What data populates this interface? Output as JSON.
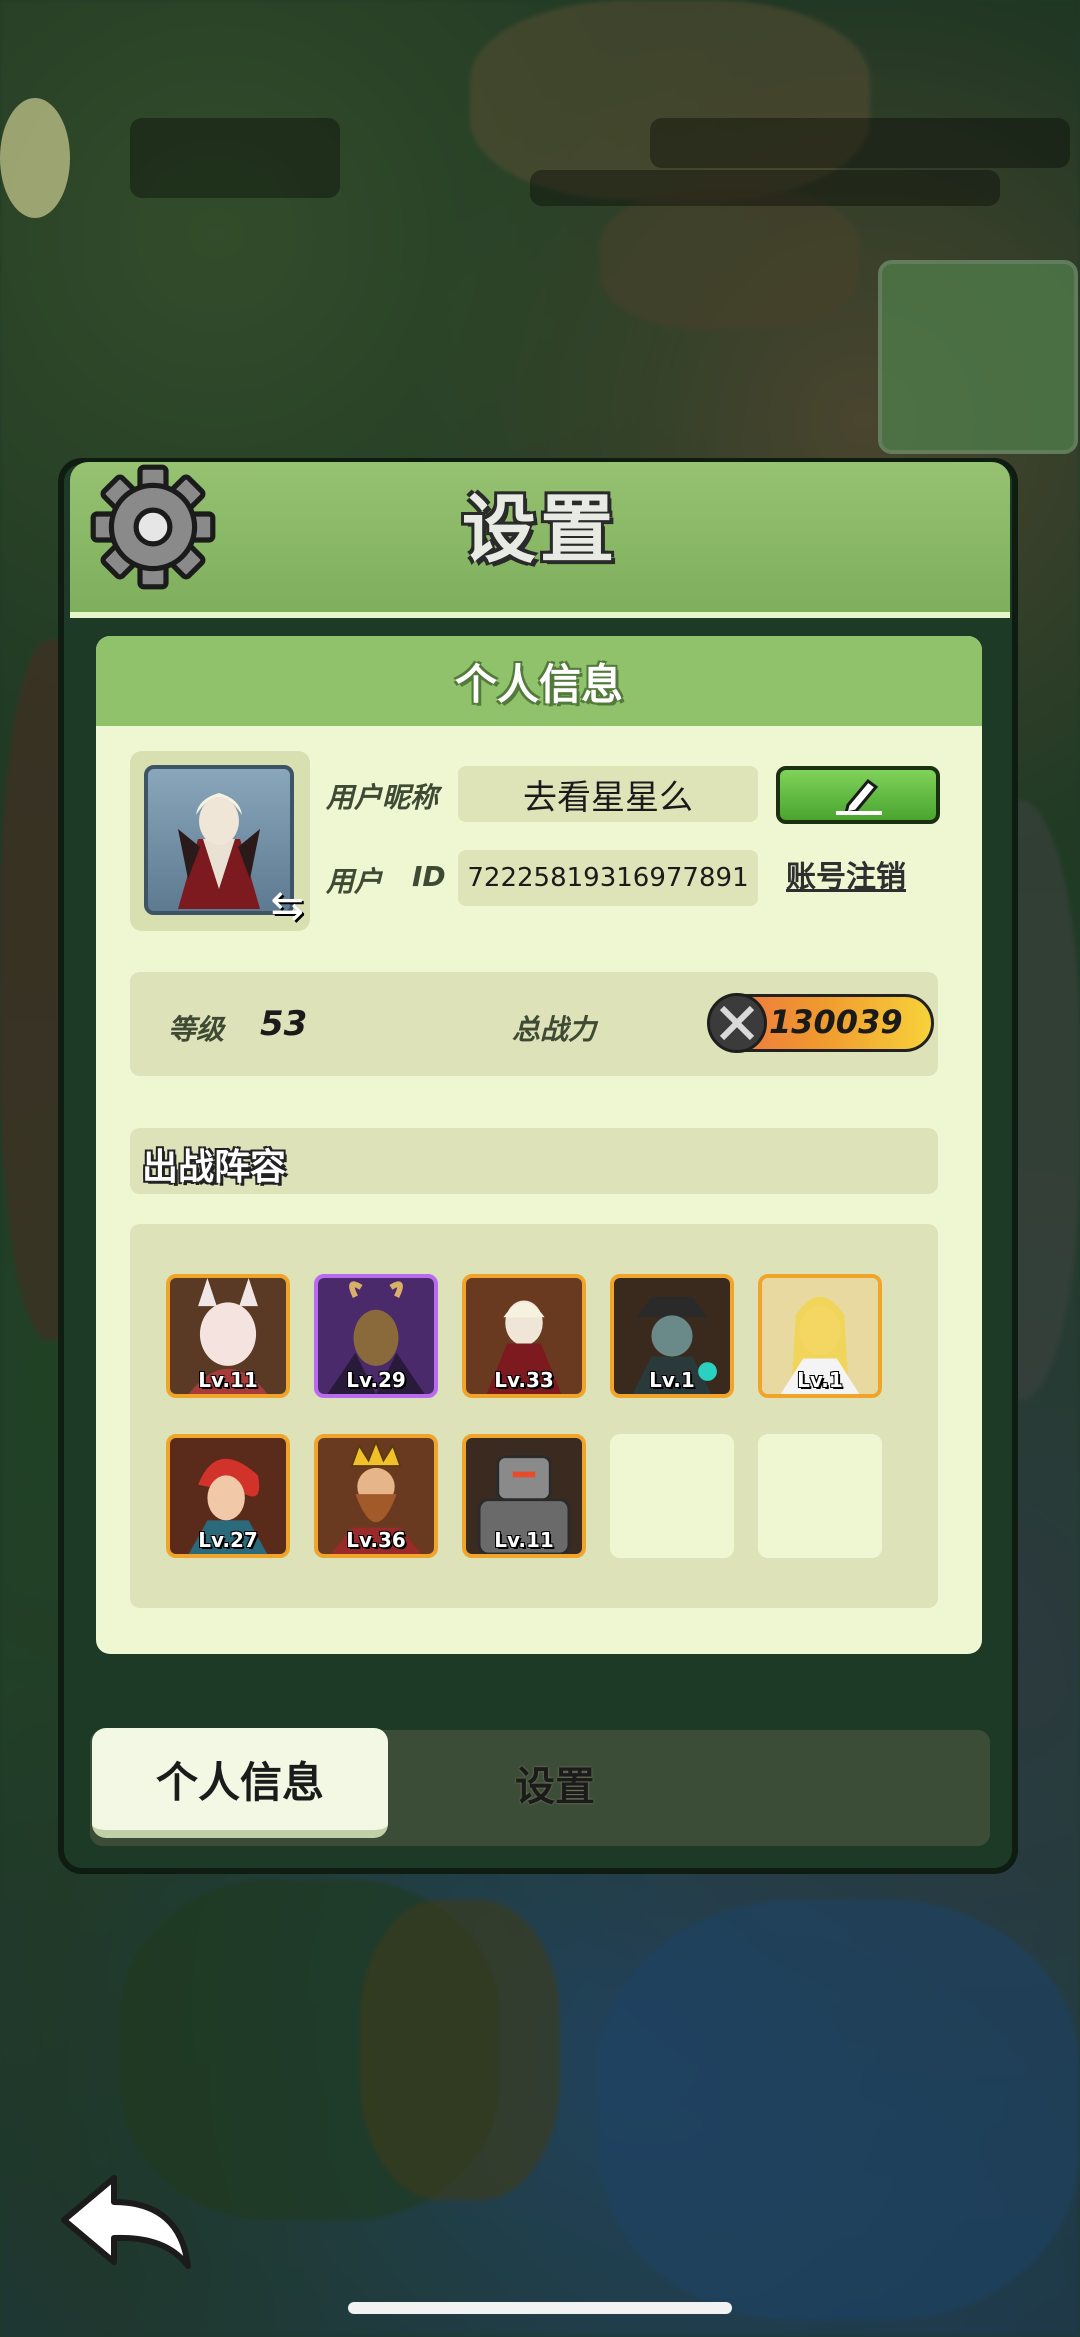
{
  "dialog": {
    "title": "设置",
    "icon": "gear-icon"
  },
  "profile_card": {
    "header": "个人信息",
    "nickname_label": "用户昵称",
    "nickname_value": "去看星星么",
    "id_label": "用户",
    "id_label_suffix": "ID",
    "id_value": "72225819316977891",
    "edit_icon": "pencil-icon",
    "delete_account": "账号注销"
  },
  "stats": {
    "level_label": "等级",
    "level_value": "53",
    "power_label": "总战力",
    "power_value": "130039",
    "power_icon": "crossed-swords-icon"
  },
  "lineup": {
    "title": "出战阵容",
    "heroes": [
      {
        "level": "Lv.11",
        "rarity": "orange"
      },
      {
        "level": "Lv.29",
        "rarity": "purple"
      },
      {
        "level": "Lv.33",
        "rarity": "orange"
      },
      {
        "level": "Lv.1",
        "rarity": "orange"
      },
      {
        "level": "Lv.1",
        "rarity": "orange"
      },
      {
        "level": "Lv.27",
        "rarity": "orange"
      },
      {
        "level": "Lv.36",
        "rarity": "orange"
      },
      {
        "level": "Lv.11",
        "rarity": "orange"
      }
    ],
    "empty_slots": 2
  },
  "tabs": [
    {
      "label": "个人信息",
      "active": true
    },
    {
      "label": "设置",
      "active": false
    }
  ],
  "navigation": {
    "back_icon": "back-arrow-icon"
  },
  "colors": {
    "accent_green": "#8fc26a",
    "card_bg": "#eef7d2",
    "hero_orange": "#f0a52a",
    "hero_purple": "#b96af0"
  }
}
